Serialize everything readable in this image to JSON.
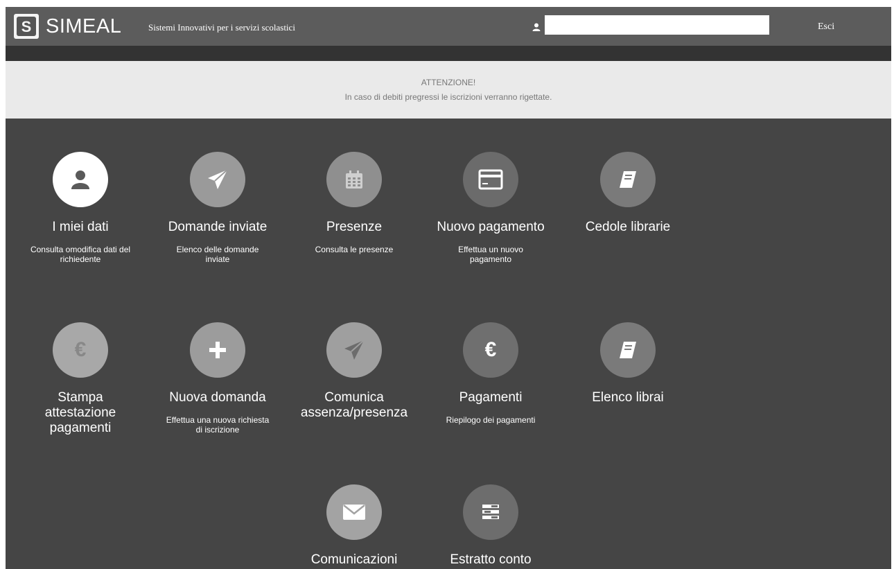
{
  "header": {
    "logo_letter": "S",
    "brand": "SIMEAL",
    "tagline": "Sistemi Innovativi per i servizi scolastici",
    "user_name": "",
    "logout_label": "Esci"
  },
  "notice": {
    "title": "ATTENZIONE!",
    "text": "In caso di debiti pregressi le iscrizioni verranno rigettate."
  },
  "tiles": [
    {
      "title": "I miei dati",
      "desc": "Consulta omodifica dati del richiedente",
      "icon": "user-icon",
      "bg": "#ffffff",
      "fg": "#5a5a5a"
    },
    {
      "title": "Domande inviate",
      "desc": "Elenco delle domande inviate",
      "icon": "paper-plane-icon",
      "bg": "#9a9a9a",
      "fg": "#ffffff"
    },
    {
      "title": "Presenze",
      "desc": "Consulta le presenze",
      "icon": "calendar-icon",
      "bg": "#8f8f8f",
      "fg": "#cfcfcf"
    },
    {
      "title": "Nuovo pagamento",
      "desc": "Effettua un nuovo pagamento",
      "icon": "credit-card-icon",
      "bg": "#6b6b6b",
      "fg": "#ffffff"
    },
    {
      "title": "Cedole librarie",
      "desc": "",
      "icon": "book-icon",
      "bg": "#7a7a7a",
      "fg": "#ffffff"
    },
    {
      "title": "Stampa attestazione pagamenti",
      "desc": "",
      "icon": "euro-icon",
      "bg": "#a8a8a8",
      "fg": "#888888"
    },
    {
      "title": "Nuova domanda",
      "desc": "Effettua una nuova richiesta di iscrizione",
      "icon": "plus-icon",
      "bg": "#9c9c9c",
      "fg": "#ffffff"
    },
    {
      "title": "Comunica assenza/presenza",
      "desc": "",
      "icon": "paper-plane-icon",
      "bg": "#9f9f9f",
      "fg": "#6c6c6c"
    },
    {
      "title": "Pagamenti",
      "desc": "Riepilogo dei pagamenti",
      "icon": "euro-icon",
      "bg": "#6f6f6f",
      "fg": "#ffffff"
    },
    {
      "title": "Elenco librai",
      "desc": "",
      "icon": "book-icon",
      "bg": "#7a7a7a",
      "fg": "#ffffff"
    },
    {
      "title": "Comunicazioni",
      "desc": "",
      "icon": "envelope-icon",
      "bg": "#a3a3a3",
      "fg": "#ffffff"
    },
    {
      "title": "Estratto conto",
      "desc": "",
      "icon": "list-icon",
      "bg": "#6d6d6d",
      "fg": "#ffffff"
    }
  ]
}
